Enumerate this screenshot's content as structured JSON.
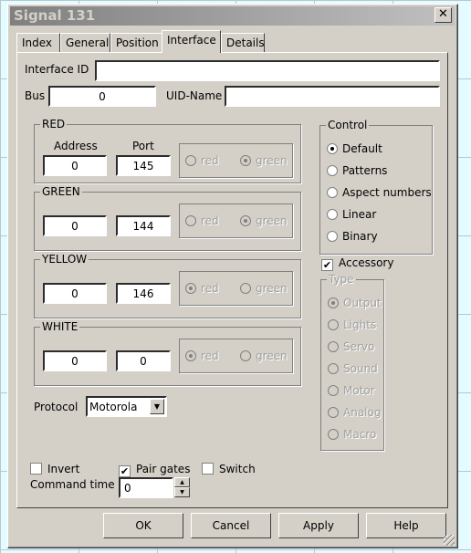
{
  "window": {
    "title": "Signal 131",
    "close": "✕"
  },
  "tabs": [
    "Index",
    "General",
    "Position",
    "Interface",
    "Details"
  ],
  "selected_tab": "Interface",
  "interface_id": {
    "label": "Interface ID",
    "value": ""
  },
  "bus": {
    "label": "Bus",
    "value": "0"
  },
  "uid_name": {
    "label": "UID-Name",
    "value": ""
  },
  "col_address": "Address",
  "col_port": "Port",
  "colors": [
    {
      "label": "RED",
      "address": "0",
      "port": "145",
      "red": "red",
      "green": "green",
      "selected": "green"
    },
    {
      "label": "GREEN",
      "address": "0",
      "port": "144",
      "red": "red",
      "green": "green",
      "selected": "green"
    },
    {
      "label": "YELLOW",
      "address": "0",
      "port": "146",
      "red": "red",
      "green": "green",
      "selected": "red"
    },
    {
      "label": "WHITE",
      "address": "0",
      "port": "0",
      "red": "red",
      "green": "green",
      "selected": "red"
    }
  ],
  "control": {
    "label": "Control",
    "options": [
      "Default",
      "Patterns",
      "Aspect numbers",
      "Linear",
      "Binary"
    ],
    "selected": "Default"
  },
  "accessory": {
    "label": "Accessory",
    "checked": true
  },
  "type": {
    "label": "Type",
    "options": [
      "Output",
      "Lights",
      "Servo",
      "Sound",
      "Motor",
      "Analog",
      "Macro"
    ],
    "selected": "Output",
    "disabled": true
  },
  "protocol": {
    "label": "Protocol",
    "value": "Motorola"
  },
  "invert": {
    "label": "Invert",
    "checked": false
  },
  "pair_gates": {
    "label": "Pair gates",
    "checked": true
  },
  "switch": {
    "label": "Switch",
    "checked": false
  },
  "command_time": {
    "label": "Command time",
    "value": "0"
  },
  "buttons": {
    "ok": "OK",
    "cancel": "Cancel",
    "apply": "Apply",
    "help": "Help"
  }
}
